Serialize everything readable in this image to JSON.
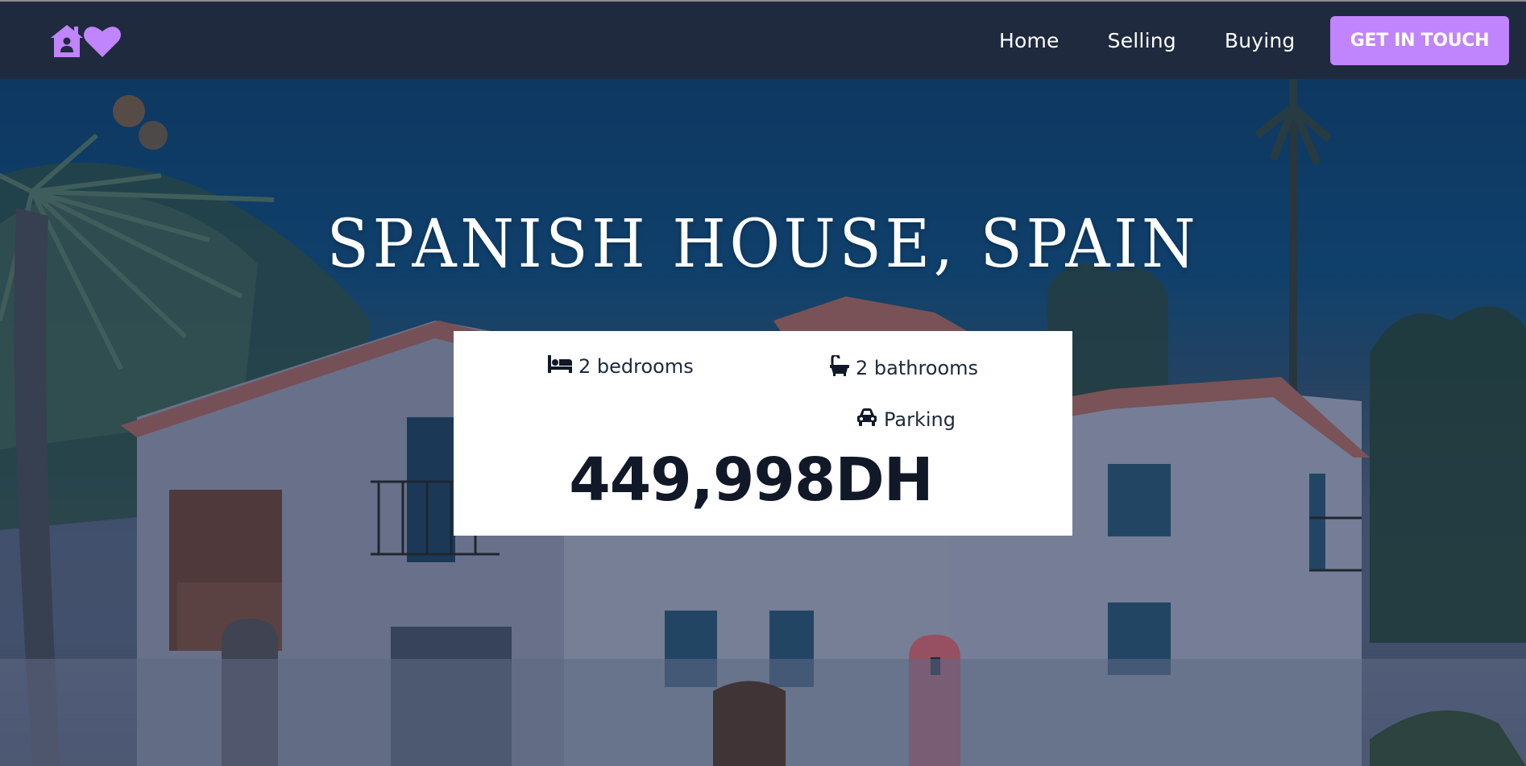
{
  "nav": {
    "logo_icon": "house-heart-logo",
    "links": [
      {
        "label": "Home"
      },
      {
        "label": "Selling"
      },
      {
        "label": "Buying"
      }
    ],
    "cta_label": "GET IN TOUCH"
  },
  "hero": {
    "title": "SPANISH HOUSE, SPAIN",
    "background": "spanish-house-photo"
  },
  "listing": {
    "bedrooms": "2 bedrooms",
    "bathrooms": "2 bathrooms",
    "parking": "Parking",
    "price": "449,998DH",
    "icons": {
      "bedrooms": "bed-icon",
      "bathrooms": "bath-icon",
      "parking": "car-icon"
    }
  },
  "colors": {
    "nav_bg": "#1f2a3f",
    "accent": "#c084fc",
    "card_bg": "#ffffff",
    "text_dark": "#111827"
  }
}
